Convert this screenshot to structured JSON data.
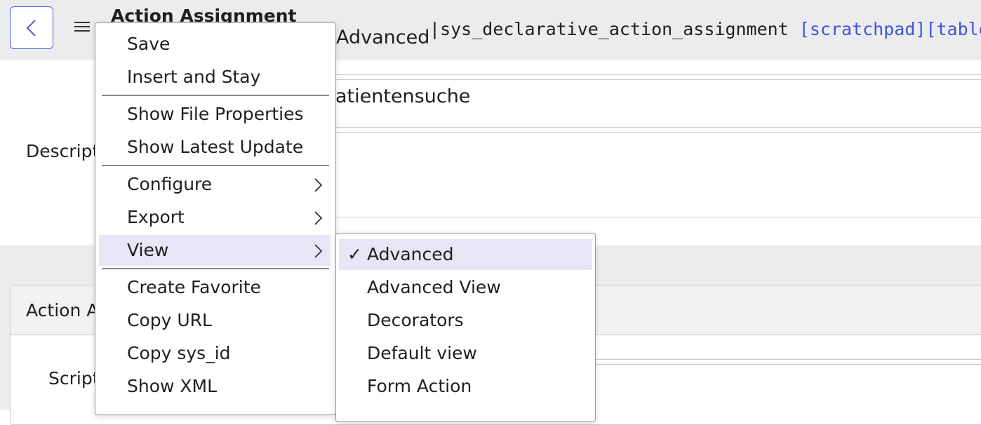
{
  "header": {
    "title": "Action Assignment",
    "view_name": "Advanced",
    "separator": "|",
    "table_name": "sys_declarative_action_assignment",
    "scratchpad_link": "[scratchpad]",
    "table_link": "[table f"
  },
  "form": {
    "name_value": "atientensuche",
    "description_label": "Descript",
    "section_title": "Action A",
    "script_label": "Script"
  },
  "context_menu": {
    "items": [
      {
        "label": "Save"
      },
      {
        "label": "Insert and Stay"
      },
      {
        "label": "Show File Properties"
      },
      {
        "label": "Show Latest Update"
      },
      {
        "label": "Configure",
        "submenu": true
      },
      {
        "label": "Export",
        "submenu": true
      },
      {
        "label": "View",
        "submenu": true,
        "active": true
      },
      {
        "label": "Create Favorite"
      },
      {
        "label": "Copy URL"
      },
      {
        "label": "Copy sys_id"
      },
      {
        "label": "Show XML"
      }
    ]
  },
  "view_submenu": {
    "items": [
      {
        "label": "Advanced",
        "checked": true
      },
      {
        "label": "Advanced View"
      },
      {
        "label": "Decorators"
      },
      {
        "label": "Default view"
      },
      {
        "label": "Form Action"
      }
    ],
    "check_glyph": "✓"
  },
  "colors": {
    "accent": "#4f5ed1",
    "link": "#3b55d6",
    "header_bg": "#ececef",
    "menu_active_bg": "#e6e6f5"
  }
}
